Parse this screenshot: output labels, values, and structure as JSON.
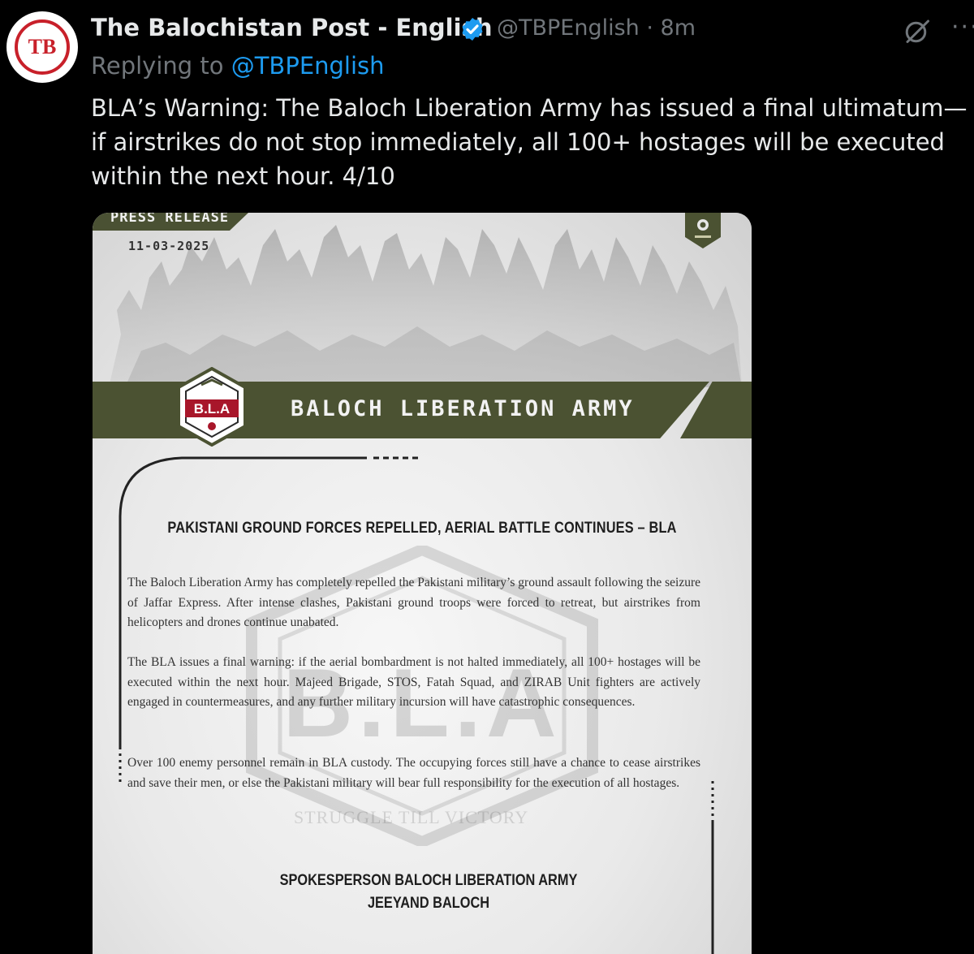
{
  "tweet": {
    "display_name": "The Balochistan Post - English",
    "handle_time": "@TBPEnglish · 8m",
    "reply_prefix": "Replying to",
    "reply_handle": "@TBPEnglish",
    "text": "BLA’s Warning: The Baloch Liberation Army has issued a final ultimatum—if airstrikes do not stop immediately, all 100+ hostages will be executed within the next hour. 4/10",
    "more_label": "···",
    "avatar_initials": "TB"
  },
  "press_release": {
    "label": "PRESS RELEASE",
    "date": "11-03-2025",
    "organization": "BALOCH LIBERATION ARMY",
    "badge_text": "B.L.A",
    "headline": "PAKISTANI GROUND FORCES REPELLED, AERIAL BATTLE CONTINUES – BLA",
    "paragraphs": [
      "The Baloch Liberation Army has completely repelled the Pakistani military’s ground assault following the seizure of Jaffar Express. After intense clashes, Pakistani ground troops were forced to retreat, but airstrikes from helicopters and drones continue unabated.",
      "The BLA issues a final warning: if the aerial bombardment is not halted immediately, all 100+ hostages will be executed within the next hour. Majeed Brigade, STOS, Fatah Squad, and ZIRAB Unit fighters are actively engaged in countermeasures, and any further military incursion will have catastrophic consequences.",
      "Over 100 enemy personnel remain in BLA custody. The occupying forces still have a chance to cease airstrikes and save their men, or else the Pakistani military will bear full responsibility for the execution of all hostages."
    ],
    "watermark_letters": "B.L.A",
    "watermark_motto": "STRUGGLE TILL VICTORY",
    "signature_title": "SPOKESPERSON BALOCH LIBERATION ARMY",
    "signature_name": "JEEYAND BALOCH"
  },
  "colors": {
    "background": "#000000",
    "text": "#e7e9ea",
    "muted": "#71767b",
    "link": "#1d9bf0",
    "banner_green": "#4b5232"
  },
  "icons": [
    "avatar-logo",
    "verified-badge-icon",
    "grok-icon",
    "more-icon",
    "bla-emblem-icon"
  ]
}
